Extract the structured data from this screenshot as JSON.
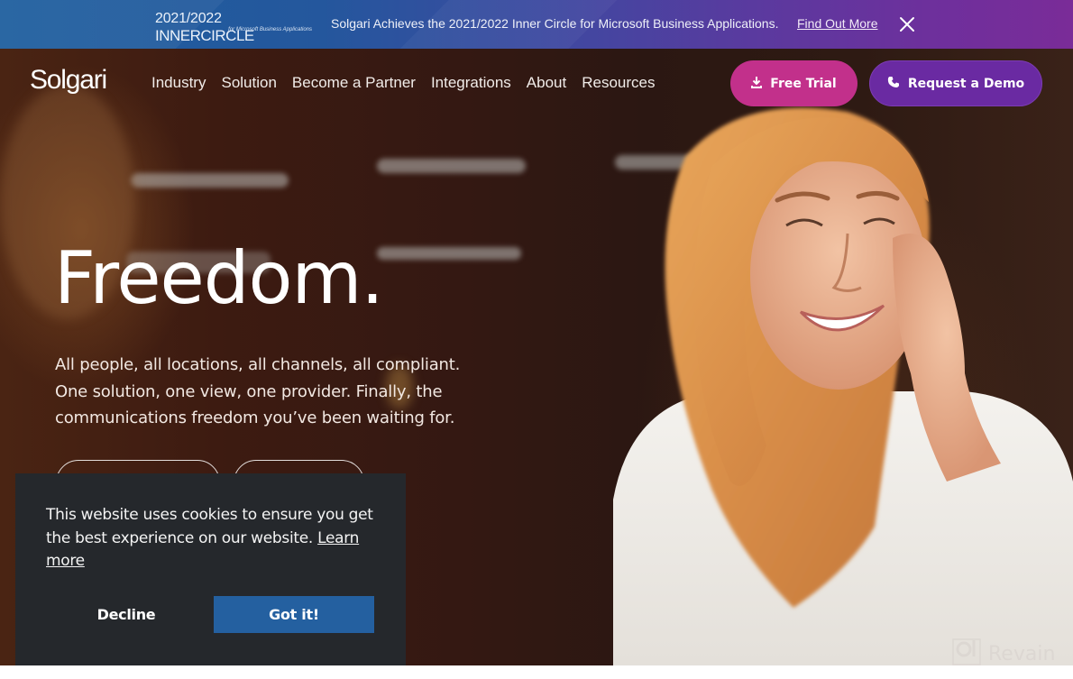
{
  "announcement": {
    "badge_year": "2021/2022",
    "badge_name": "INNERCIRCLE",
    "badge_subtitle": "for Microsoft Business Applications",
    "message": "Solgari Achieves the 2021/2022 Inner Circle for Microsoft Business Applications.",
    "link_label": "Find Out More",
    "close_icon": "close-icon"
  },
  "header": {
    "brand": "Solgari",
    "nav": [
      {
        "label": "Industry"
      },
      {
        "label": "Solution"
      },
      {
        "label": "Become a Partner"
      },
      {
        "label": "Integrations"
      },
      {
        "label": "About"
      },
      {
        "label": "Resources"
      }
    ],
    "free_trial": {
      "label": "Free Trial",
      "icon": "download-icon",
      "color": "#c2308b"
    },
    "request_demo": {
      "label": "Request a Demo",
      "icon": "phone-icon",
      "color": "#6a2aa2"
    }
  },
  "hero": {
    "headline": "Freedom.",
    "subtext": "All people, all locations, all channels, all compliant. One solution, one view, one provider. Finally, the communications freedom you’ve been waiting for."
  },
  "cookie_banner": {
    "message": "This website uses cookies to ensure you get the best experience on our website.",
    "learn_more": "Learn more",
    "decline_label": "Decline",
    "accept_label": "Got it!",
    "accept_color": "#2460a0",
    "background": "#25282c"
  },
  "watermark": {
    "text": "Revain"
  }
}
